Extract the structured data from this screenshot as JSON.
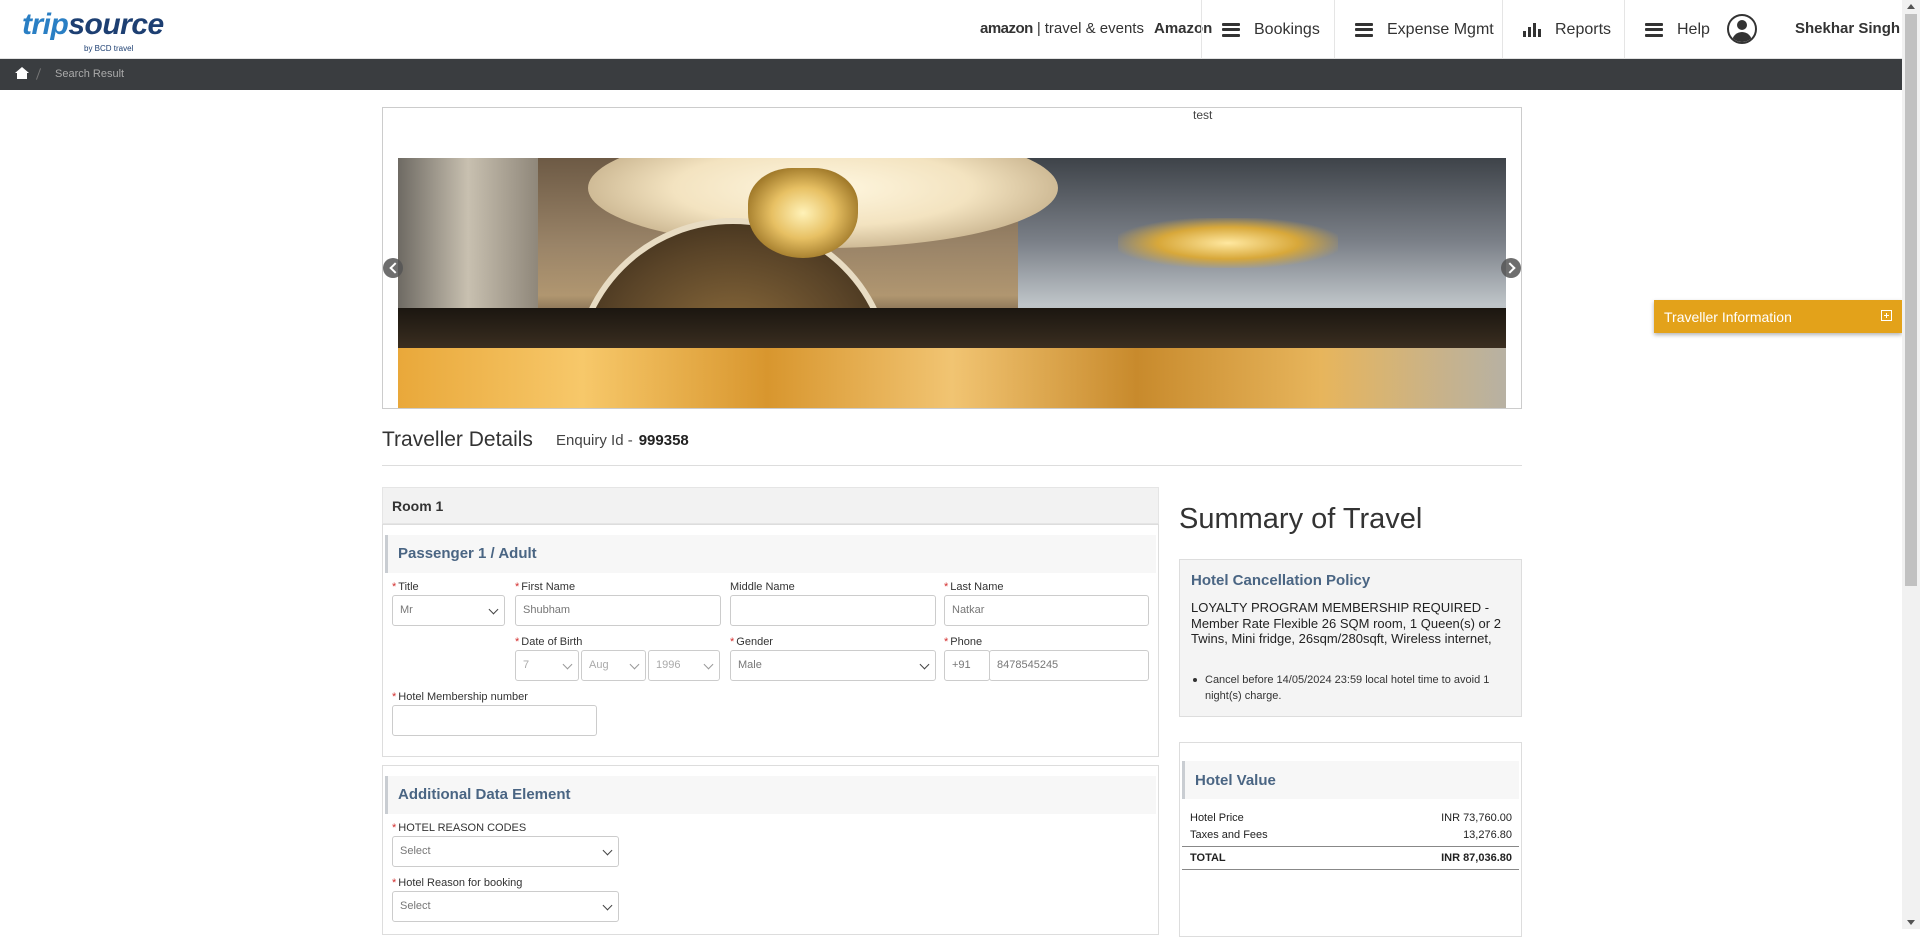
{
  "header": {
    "logo_trip": "trip",
    "logo_source": "source",
    "logo_sub": "by BCD travel",
    "amazon_brand": "amazon",
    "amazon_tag": "travel & events",
    "company": "Amazon",
    "nav": [
      {
        "label": "Bookings",
        "icon": "menu-icon"
      },
      {
        "label": "Expense Mgmt",
        "icon": "menu-icon"
      },
      {
        "label": "Reports",
        "icon": "bar-chart-icon"
      },
      {
        "label": "Help",
        "icon": "menu-icon"
      }
    ],
    "user_name": "Shekhar Singh"
  },
  "breadcrumb": {
    "current": "Search Result"
  },
  "carousel": {
    "caption": "test"
  },
  "traveller_tab": {
    "label": "Traveller Information"
  },
  "traveller_details": {
    "heading": "Traveller Details",
    "enquiry_label": "Enquiry Id -",
    "enquiry_id": "999358"
  },
  "room": {
    "title": "Room 1",
    "passenger_heading": "Passenger 1 / Adult",
    "fields": {
      "title": {
        "label": "Title",
        "value": "Mr"
      },
      "first_name": {
        "label": "First Name",
        "value": "Shubham"
      },
      "middle_name": {
        "label": "Middle Name",
        "value": ""
      },
      "last_name": {
        "label": "Last Name",
        "value": "Natkar"
      },
      "dob": {
        "label": "Date of Birth",
        "day": "7",
        "month": "Aug",
        "year": "1996"
      },
      "gender": {
        "label": "Gender",
        "value": "Male"
      },
      "phone": {
        "label": "Phone",
        "code": "+91",
        "number": "8478545245"
      },
      "membership": {
        "label": "Hotel Membership number",
        "value": ""
      }
    }
  },
  "additional": {
    "heading": "Additional Data Element",
    "reason_codes": {
      "label": "HOTEL REASON CODES",
      "value": "Select"
    },
    "reason_booking": {
      "label": "Hotel Reason for booking",
      "value": "Select"
    }
  },
  "summary": {
    "title": "Summary of Travel",
    "policy_title": "Hotel Cancellation Policy",
    "policy_text": "LOYALTY PROGRAM MEMBERSHIP REQUIRED - Member Rate Flexible 26 SQM room, 1 Queen(s) or 2 Twins, Mini fridge, 26sqm/280sqft, Wireless internet,",
    "policy_bullet": "Cancel before 14/05/2024 23:59 local hotel time to avoid 1 night(s) charge.",
    "value_title": "Hotel Value",
    "rows": [
      {
        "label": "Hotel Price",
        "value": "INR 73,760.00"
      },
      {
        "label": "Taxes and Fees",
        "value": "13,276.80"
      }
    ],
    "total_label": "TOTAL",
    "total_value": "INR 87,036.80"
  }
}
